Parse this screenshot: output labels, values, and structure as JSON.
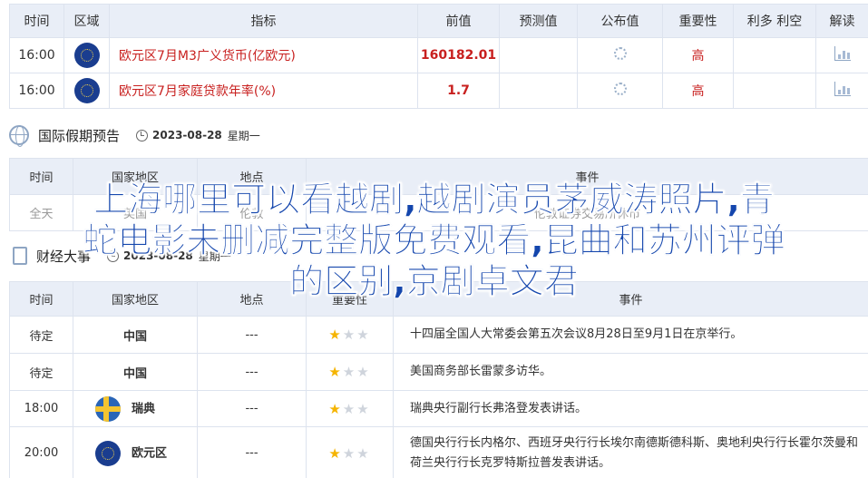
{
  "top_table": {
    "headers": [
      "时间",
      "区域",
      "指标",
      "前值",
      "预测值",
      "公布值",
      "重要性",
      "利多 利空",
      "解读"
    ],
    "rows": [
      {
        "time": "16:00",
        "region_icon": "eu-flag-icon",
        "indicator": "欧元区7月M3广义货币(亿欧元)",
        "previous": "160182.01",
        "forecast": "",
        "actual_icon": "loading-icon",
        "importance": "高",
        "impact": "",
        "interpret_icon": "chart-icon"
      },
      {
        "time": "16:00",
        "region_icon": "eu-flag-icon",
        "indicator": "欧元区7月家庭贷款年率(%)",
        "previous": "1.7",
        "forecast": "",
        "actual_icon": "loading-icon",
        "importance": "高",
        "impact": "",
        "interpret_icon": "chart-icon"
      }
    ]
  },
  "holiday_section": {
    "title": "国际假期预告",
    "date": "2023-08-28",
    "weekday": "星期一",
    "headers": [
      "时间",
      "国家地区",
      "地点",
      "事件"
    ],
    "rows": [
      {
        "time": "全天",
        "region": "英国",
        "place": "伦敦",
        "event": "伦敦证券交易所休市"
      }
    ]
  },
  "finance_section": {
    "title": "财经大事",
    "date": "2023-08-28",
    "weekday": "星期一"
  },
  "events_table": {
    "headers": [
      "时间",
      "国家地区",
      "地点",
      "重要性",
      "事件"
    ],
    "rows": [
      {
        "time": "待定",
        "region": "中国",
        "flag": "",
        "place": "---",
        "stars": 1,
        "event": "十四届全国人大常委会第五次会议8月28日至9月1日在京举行。"
      },
      {
        "time": "待定",
        "region": "中国",
        "flag": "",
        "place": "---",
        "stars": 1,
        "event": "美国商务部长雷蒙多访华。"
      },
      {
        "time": "18:00",
        "region": "瑞典",
        "flag": "se",
        "place": "---",
        "stars": 1,
        "event": "瑞典央行副行长弗洛登发表讲话。"
      },
      {
        "time": "20:00",
        "region": "欧元区",
        "flag": "eu",
        "place": "---",
        "stars": 1,
        "event": "德国央行行长内格尔、西班牙央行行长埃尔南德斯德科斯、奥地利央行行长霍尔茨曼和荷兰央行行长克罗特斯拉普发表讲话。"
      }
    ]
  },
  "overlay": {
    "line1": "上海哪里可以看越剧,越剧演员茅威涛照片,青",
    "line2": "蛇电影未删减完整版免费观看,昆曲和苏州评弹",
    "line3": "的区别,京剧卓文君"
  },
  "colors": {
    "accent_red": "#c8201f",
    "header_bg": "#e9eef7",
    "overlay_blue": "#1446ad",
    "star": "#f5b400"
  }
}
